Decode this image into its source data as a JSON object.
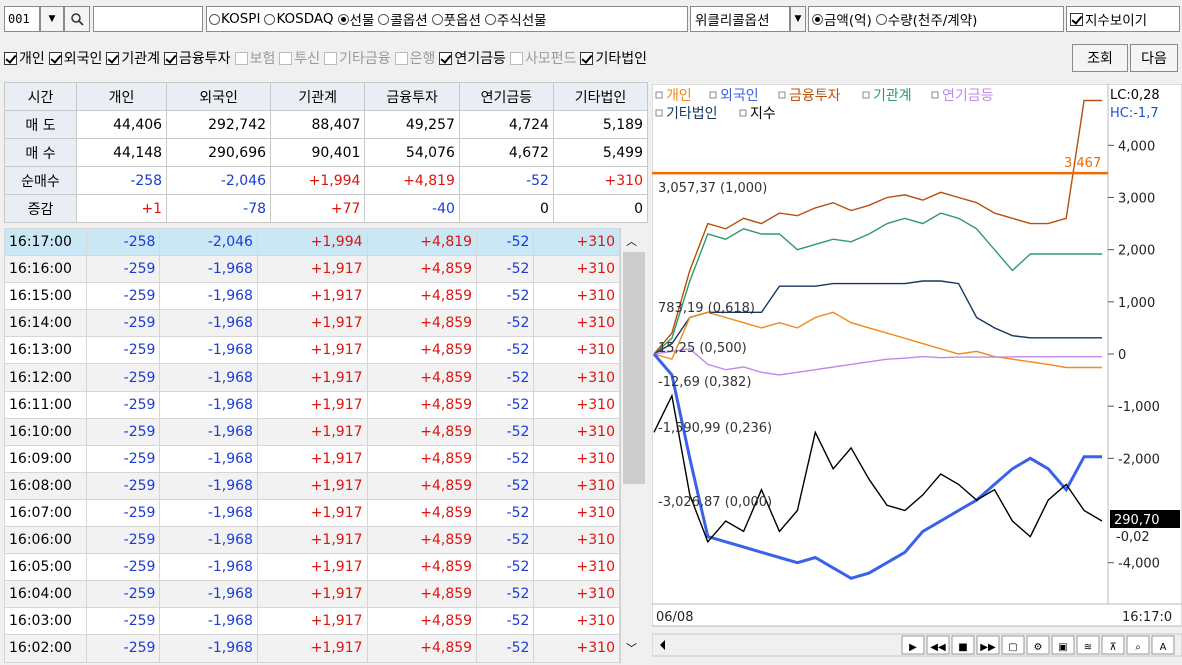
{
  "toolbar": {
    "code": "001",
    "markets": [
      {
        "label": "KOSPI",
        "selected": false
      },
      {
        "label": "KOSDAQ",
        "selected": false
      },
      {
        "label": "선물",
        "selected": true
      },
      {
        "label": "콜옵션",
        "selected": false
      },
      {
        "label": "풋옵션",
        "selected": false
      },
      {
        "label": "주식선물",
        "selected": false
      }
    ],
    "dropdown_value": "위클리콜옵션",
    "units": [
      {
        "label": "금액(억)",
        "selected": true
      },
      {
        "label": "수량(천주/계약)",
        "selected": false
      }
    ],
    "show_index_label": "지수보이기"
  },
  "investors": [
    {
      "label": "개인",
      "checked": true
    },
    {
      "label": "외국인",
      "checked": true
    },
    {
      "label": "기관계",
      "checked": true
    },
    {
      "label": "금융투자",
      "checked": true
    },
    {
      "label": "보험",
      "checked": false
    },
    {
      "label": "투신",
      "checked": false
    },
    {
      "label": "기타금융",
      "checked": false
    },
    {
      "label": "은행",
      "checked": false
    },
    {
      "label": "연기금등",
      "checked": true
    },
    {
      "label": "사모펀드",
      "checked": false
    },
    {
      "label": "기타법인",
      "checked": true
    }
  ],
  "buttons": {
    "query": "조회",
    "next": "다음"
  },
  "summary": {
    "headers": [
      "시간",
      "개인",
      "외국인",
      "기관계",
      "금융투자",
      "연기금등",
      "기타법인"
    ],
    "rows": [
      {
        "label": "매 도",
        "values": [
          "44,406",
          "292,742",
          "88,407",
          "49,257",
          "4,724",
          "5,189"
        ]
      },
      {
        "label": "매 수",
        "values": [
          "44,148",
          "290,696",
          "90,401",
          "54,076",
          "4,672",
          "5,499"
        ]
      },
      {
        "label": "순매수",
        "values": [
          "-258",
          "-2,046",
          "+1,994",
          "+4,819",
          "-52",
          "+310"
        ]
      },
      {
        "label": "증감",
        "values": [
          "+1",
          "-78",
          "+77",
          "-40",
          "0",
          "0"
        ]
      }
    ]
  },
  "detail_rows": [
    [
      "16:17:00",
      "-258",
      "-2,046",
      "+1,994",
      "+4,819",
      "-52",
      "+310"
    ],
    [
      "16:16:00",
      "-259",
      "-1,968",
      "+1,917",
      "+4,859",
      "-52",
      "+310"
    ],
    [
      "16:15:00",
      "-259",
      "-1,968",
      "+1,917",
      "+4,859",
      "-52",
      "+310"
    ],
    [
      "16:14:00",
      "-259",
      "-1,968",
      "+1,917",
      "+4,859",
      "-52",
      "+310"
    ],
    [
      "16:13:00",
      "-259",
      "-1,968",
      "+1,917",
      "+4,859",
      "-52",
      "+310"
    ],
    [
      "16:12:00",
      "-259",
      "-1,968",
      "+1,917",
      "+4,859",
      "-52",
      "+310"
    ],
    [
      "16:11:00",
      "-259",
      "-1,968",
      "+1,917",
      "+4,859",
      "-52",
      "+310"
    ],
    [
      "16:10:00",
      "-259",
      "-1,968",
      "+1,917",
      "+4,859",
      "-52",
      "+310"
    ],
    [
      "16:09:00",
      "-259",
      "-1,968",
      "+1,917",
      "+4,859",
      "-52",
      "+310"
    ],
    [
      "16:08:00",
      "-259",
      "-1,968",
      "+1,917",
      "+4,859",
      "-52",
      "+310"
    ],
    [
      "16:07:00",
      "-259",
      "-1,968",
      "+1,917",
      "+4,859",
      "-52",
      "+310"
    ],
    [
      "16:06:00",
      "-259",
      "-1,968",
      "+1,917",
      "+4,859",
      "-52",
      "+310"
    ],
    [
      "16:05:00",
      "-259",
      "-1,968",
      "+1,917",
      "+4,859",
      "-52",
      "+310"
    ],
    [
      "16:04:00",
      "-259",
      "-1,968",
      "+1,917",
      "+4,859",
      "-52",
      "+310"
    ],
    [
      "16:03:00",
      "-259",
      "-1,968",
      "+1,917",
      "+4,859",
      "-52",
      "+310"
    ],
    [
      "16:02:00",
      "-259",
      "-1,968",
      "+1,917",
      "+4,859",
      "-52",
      "+310"
    ]
  ],
  "chart_data": {
    "type": "line",
    "legend": [
      {
        "name": "개인",
        "color": "#f08a1c"
      },
      {
        "name": "외국인",
        "color": "#3a62e8"
      },
      {
        "name": "금융투자",
        "color": "#b8500e"
      },
      {
        "name": "기관계",
        "color": "#2e9a6a"
      },
      {
        "name": "연기금등",
        "color": "#c08ae8"
      },
      {
        "name": "기타법인",
        "color": "#17365f"
      },
      {
        "name": "지수",
        "color": "#000000"
      }
    ],
    "legend_placement": "top-left",
    "y_ticks": [
      "4,000",
      "3,000",
      "2,000",
      "1,000",
      "0",
      "-1,000",
      "-2,000",
      "-4,000"
    ],
    "ylim": [
      -4600,
      4600
    ],
    "fib_labels": [
      "3,057,37 (1,000)",
      "783,19 (0,618)",
      "15,25 (0,500)",
      "-12,69 (0,382)",
      "-1,590,99 (0,236)",
      "-3,026,87 (0,000)"
    ],
    "hline_label": "3,467",
    "lc_label": "LC:0,28",
    "hc_label": "HC:-1,7",
    "index_badge": "290,70",
    "index_sub": "-0,02",
    "x_start": "06/08",
    "x_end": "16:17:0",
    "series": [
      {
        "name": "금융투자",
        "color": "#b8500e",
        "values": [
          0,
          400,
          1600,
          2500,
          2400,
          2600,
          2500,
          2700,
          2650,
          2800,
          2900,
          2750,
          2850,
          3000,
          3050,
          2950,
          3100,
          3000,
          2900,
          2700,
          2600,
          2500,
          2500,
          2600,
          4859,
          4859
        ]
      },
      {
        "name": "기관계",
        "color": "#2e9a6a",
        "values": [
          0,
          300,
          1400,
          2300,
          2200,
          2400,
          2300,
          2300,
          2000,
          2100,
          2200,
          2150,
          2300,
          2500,
          2600,
          2500,
          2700,
          2600,
          2400,
          2000,
          1600,
          1917,
          1917,
          1917,
          1917,
          1917
        ]
      },
      {
        "name": "기타법인",
        "color": "#17365f",
        "values": [
          0,
          200,
          700,
          800,
          800,
          800,
          800,
          1300,
          1300,
          1300,
          1350,
          1350,
          1350,
          1350,
          1350,
          1400,
          1400,
          1350,
          700,
          500,
          350,
          310,
          310,
          310,
          310,
          310
        ]
      },
      {
        "name": "개인",
        "color": "#f08a1c",
        "values": [
          0,
          -100,
          700,
          800,
          700,
          600,
          500,
          600,
          500,
          700,
          800,
          600,
          500,
          400,
          300,
          200,
          100,
          0,
          50,
          -50,
          -100,
          -150,
          -200,
          -258,
          -258,
          -258
        ]
      },
      {
        "name": "연기금등",
        "color": "#c08ae8",
        "values": [
          0,
          50,
          100,
          -200,
          -300,
          -250,
          -350,
          -400,
          -350,
          -300,
          -250,
          -200,
          -150,
          -100,
          -80,
          -50,
          -70,
          -60,
          -60,
          -60,
          -55,
          -52,
          -52,
          -52,
          -52,
          -52
        ]
      },
      {
        "name": "외국인",
        "color": "#3a62e8",
        "values": [
          0,
          -400,
          -2000,
          -3500,
          -3600,
          -3700,
          -3800,
          -3900,
          -4000,
          -3900,
          -4100,
          -4300,
          -4200,
          -4000,
          -3800,
          -3400,
          -3200,
          -3000,
          -2800,
          -2500,
          -2200,
          -2000,
          -2200,
          -2600,
          -1968,
          -1968
        ]
      },
      {
        "name": "지수",
        "color": "#000000",
        "values": [
          -1500,
          -800,
          -2700,
          -3600,
          -3200,
          -3400,
          -2600,
          -3400,
          -3000,
          -1500,
          -2200,
          -1800,
          -2400,
          -2900,
          -3000,
          -2700,
          -2300,
          -2500,
          -2800,
          -2600,
          -3200,
          -3500,
          -2800,
          -2500,
          -3000,
          -3200
        ]
      }
    ]
  }
}
